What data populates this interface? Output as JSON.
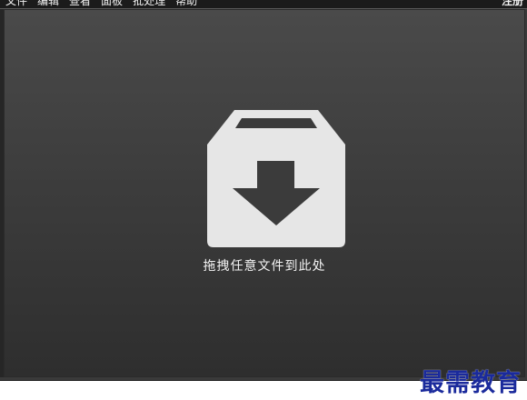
{
  "menu": {
    "items": [
      "文件",
      "编辑",
      "查看",
      "面板",
      "批处理",
      "帮助"
    ],
    "register": "注册"
  },
  "drop_zone": {
    "label": "拖拽任意文件到此处",
    "icon": "drop-box-download-icon"
  },
  "watermark": {
    "text": "最需教育"
  },
  "colors": {
    "background": "#3a3a3a",
    "icon": "#e6e6e6",
    "watermark": "#1a2a9c"
  }
}
